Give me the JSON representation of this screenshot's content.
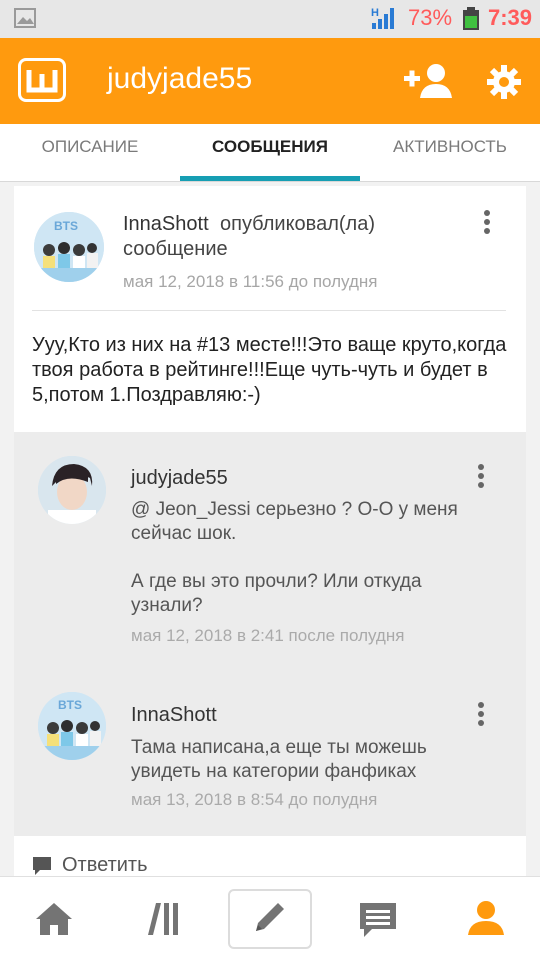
{
  "status_bar": {
    "battery_percent": "73%",
    "time": "7:39",
    "network_label": "H"
  },
  "header": {
    "logo_letter": "w",
    "title": "judyjade55"
  },
  "tabs": [
    {
      "label": "ОПИСАНИЕ"
    },
    {
      "label": "СООБЩЕНИЯ"
    },
    {
      "label": "АКТИВНОСТЬ"
    }
  ],
  "post": {
    "author": "InnaShott",
    "action": "опубликовал(ла)",
    "action_line2": "сообщение",
    "date": "мая 12, 2018 в 11:56 до полудня",
    "body": "Ууу,Кто из них на #13 месте!!!Это ваще круто,когда твоя работа в рейтинге!!!Еще чуть-чуть и будет в 5,потом 1.Поздравляю:-)"
  },
  "replies": [
    {
      "author": "judyjade55",
      "text_line1": "@ Jeon_Jessi  серьезно ? О-О  у меня сейчас шок.",
      "text_line2": "А где вы это прочли? Или откуда узнали?",
      "date": "мая 12, 2018 в 2:41 после полудня"
    },
    {
      "author": "InnaShott",
      "text_line1": "Тама написана,а еще ты можешь увидеть на категории фанфиках",
      "date": "мая 13, 2018 в 8:54 до полудня"
    }
  ],
  "reply_action": {
    "label": "Ответить"
  },
  "colors": {
    "accent_orange": "#ff9a0e",
    "tab_underline": "#169eb3",
    "status_red": "#ff5b5b"
  },
  "icons": {
    "add_user": "add-user-icon",
    "settings": "gear-icon",
    "home": "home-icon",
    "library": "library-icon",
    "write": "pencil-icon",
    "messages": "messages-icon",
    "profile": "profile-icon"
  }
}
